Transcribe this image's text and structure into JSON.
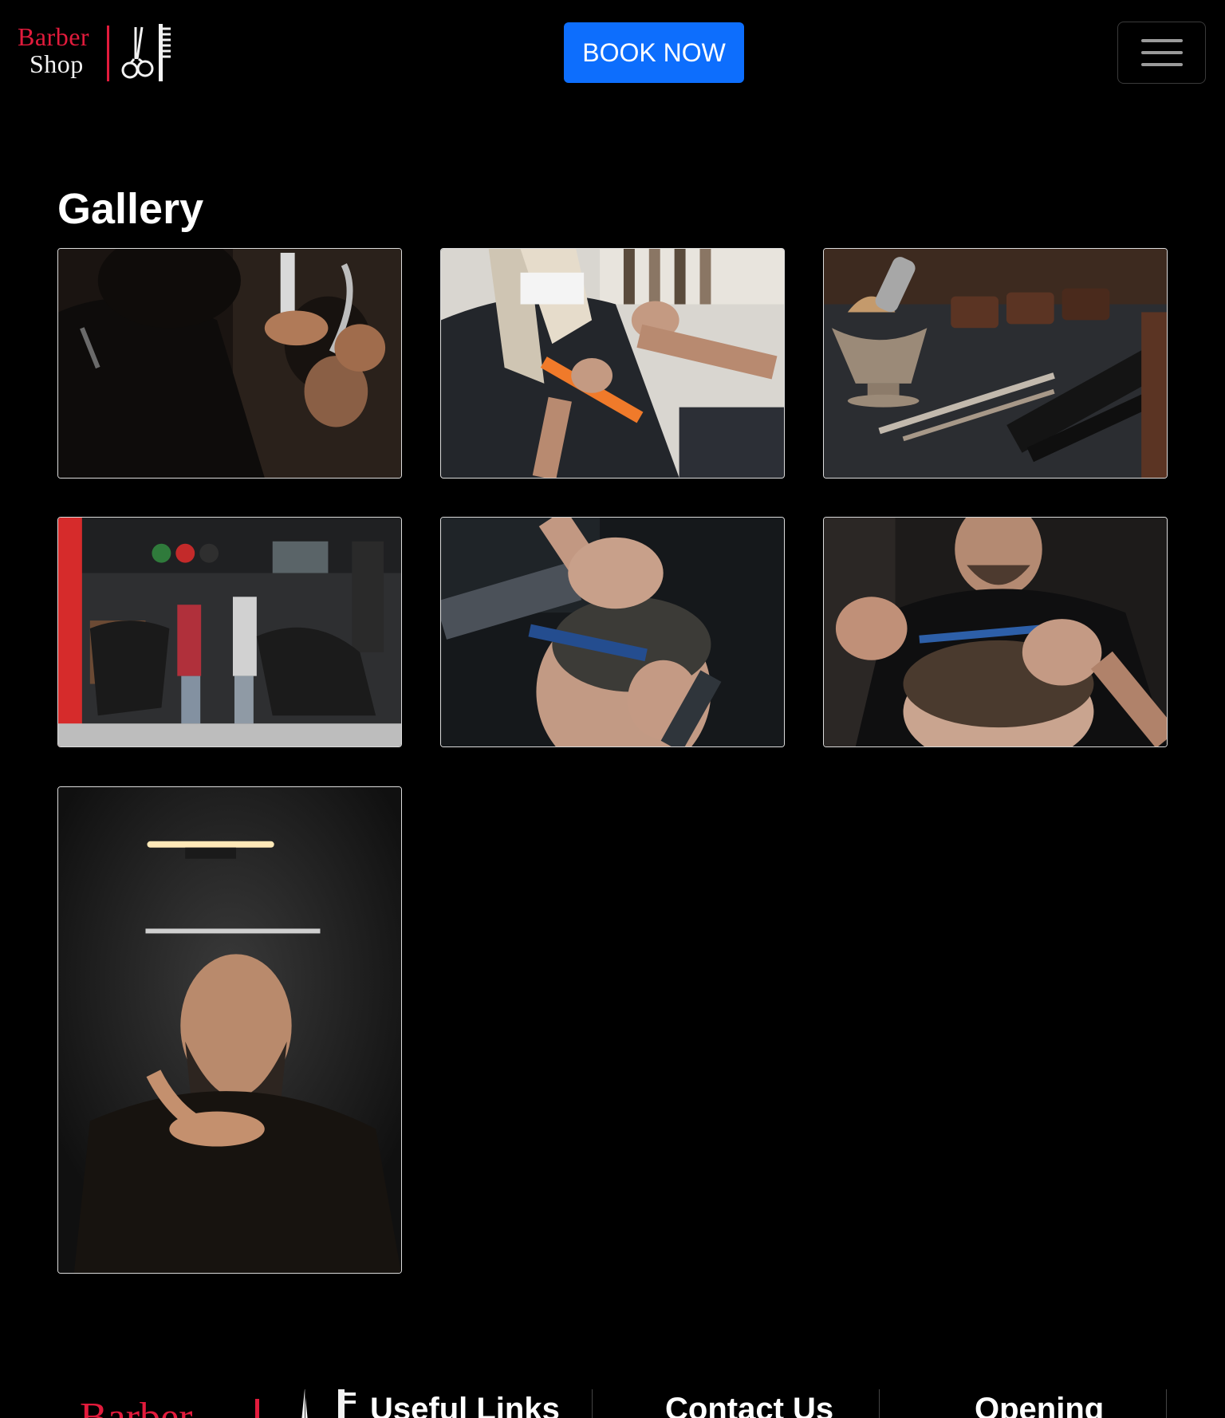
{
  "header": {
    "brand_line1": "Barber",
    "brand_line2": "Shop",
    "cta_label": "BOOK NOW",
    "menu_icon": "hamburger-icon"
  },
  "gallery": {
    "title": "Gallery",
    "images": [
      {
        "alt": "barber-cutting-hair-with-comb-and-scissors"
      },
      {
        "alt": "stylist-trimming-long-blonde-hair"
      },
      {
        "alt": "shaving-brush-razors-and-clipper-guards"
      },
      {
        "alt": "busy-barbershop-interior"
      },
      {
        "alt": "barber-cutting-short-hair-with-blue-comb"
      },
      {
        "alt": "barber-holding-comb-and-scissors-over-hair"
      },
      {
        "alt": "smiling-bearded-barber-with-floating-scissors"
      }
    ]
  },
  "footer": {
    "brand_text": "Barber",
    "headings": [
      "Useful Links",
      "Contact Us",
      "Opening"
    ]
  },
  "colors": {
    "brand_red": "#e21b3c",
    "primary_blue": "#0d6efd",
    "background": "#000000"
  }
}
